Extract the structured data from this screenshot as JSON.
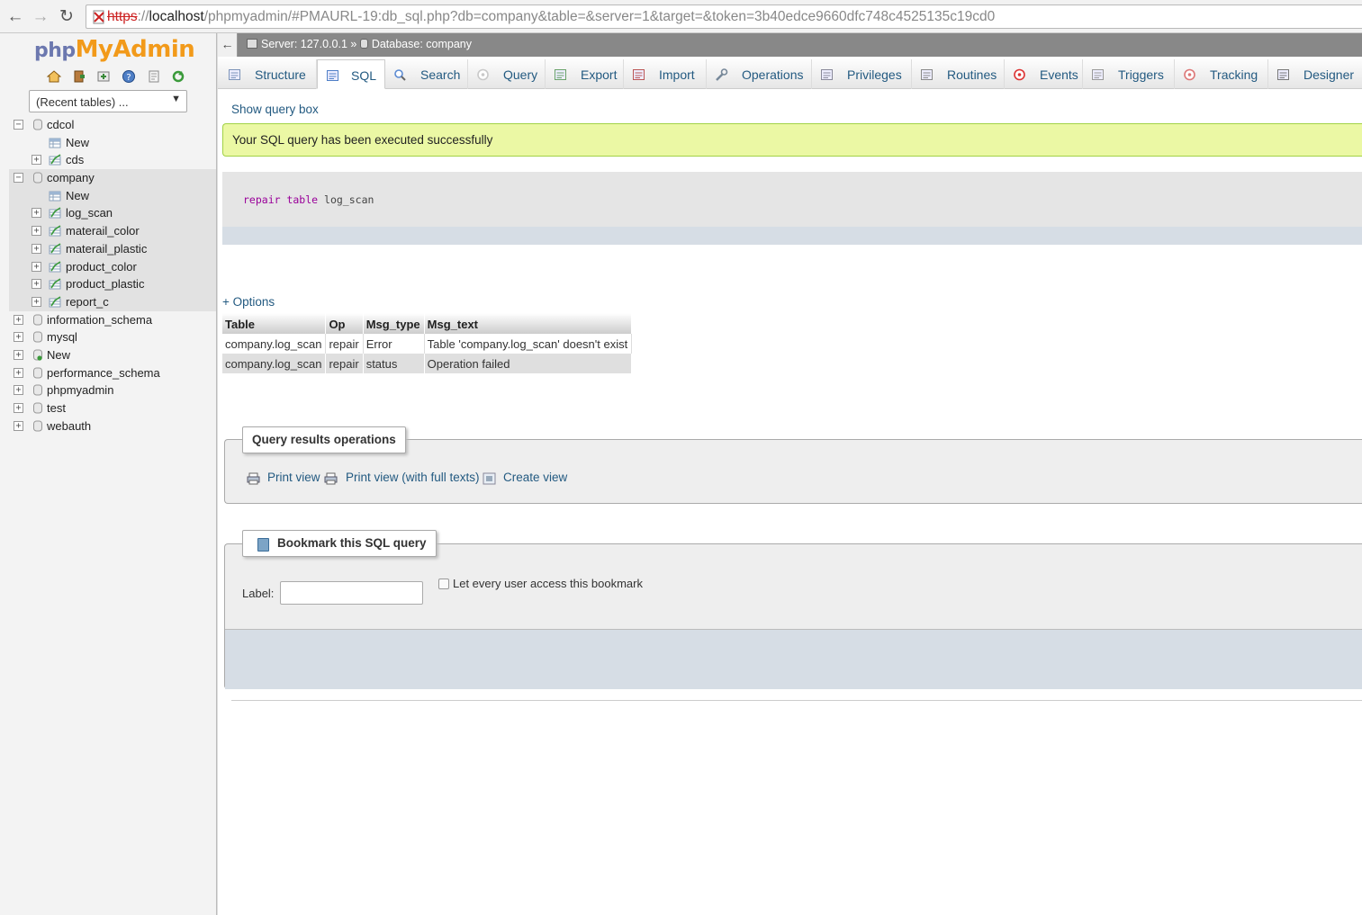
{
  "browser": {
    "url_scheme": "https",
    "url_host": "localhost",
    "url_rest": "/phpmyadmin/#PMAURL-19:db_sql.php?db=company&table=&server=1&target=&token=3b40edce9660dfc748c4525135c19cd0",
    "back_icon": "back-arrow-icon",
    "forward_icon": "forward-arrow-icon",
    "reload_icon": "reload-icon"
  },
  "sidebar": {
    "logo_php": "php",
    "logo_myadmin": "MyAdmin",
    "recent_tables": "(Recent tables) ...",
    "tree": [
      {
        "label": "cdcol",
        "type": "db",
        "expanded": true
      },
      {
        "label": "New",
        "type": "new",
        "level": 1
      },
      {
        "label": "cds",
        "type": "table",
        "level": 1
      },
      {
        "label": "company",
        "type": "db",
        "expanded": true
      },
      {
        "label": "New",
        "type": "new",
        "level": 1
      },
      {
        "label": "log_scan",
        "type": "table",
        "level": 1
      },
      {
        "label": "materail_color",
        "type": "table",
        "level": 1
      },
      {
        "label": "materail_plastic",
        "type": "table",
        "level": 1
      },
      {
        "label": "product_color",
        "type": "table",
        "level": 1
      },
      {
        "label": "product_plastic",
        "type": "table",
        "level": 1
      },
      {
        "label": "report_c",
        "type": "table",
        "level": 1
      },
      {
        "label": "information_schema",
        "type": "db"
      },
      {
        "label": "mysql",
        "type": "db"
      },
      {
        "label": "New",
        "type": "newdb"
      },
      {
        "label": "performance_schema",
        "type": "db"
      },
      {
        "label": "phpmyadmin",
        "type": "db"
      },
      {
        "label": "test",
        "type": "db"
      },
      {
        "label": "webauth",
        "type": "db"
      }
    ]
  },
  "topbar": {
    "collapse": "←",
    "server": "Server: 127.0.0.1",
    "separator": "»",
    "database": "Database: company"
  },
  "tabs": [
    {
      "label": "Structure",
      "icon": "structure-icon"
    },
    {
      "label": "SQL",
      "icon": "sql-icon",
      "active": true
    },
    {
      "label": "Search",
      "icon": "search-icon"
    },
    {
      "label": "Query",
      "icon": "query-icon"
    },
    {
      "label": "Export",
      "icon": "export-icon"
    },
    {
      "label": "Import",
      "icon": "import-icon"
    },
    {
      "label": "Operations",
      "icon": "wrench-icon"
    },
    {
      "label": "Privileges",
      "icon": "privileges-icon"
    },
    {
      "label": "Routines",
      "icon": "routines-icon"
    },
    {
      "label": "Events",
      "icon": "clock-icon"
    },
    {
      "label": "Triggers",
      "icon": "triggers-icon"
    },
    {
      "label": "Tracking",
      "icon": "eye-icon"
    },
    {
      "label": "Designer",
      "icon": "designer-icon"
    }
  ],
  "main": {
    "show_query_box": "Show query box",
    "success_message": "Your SQL query has been executed successfully",
    "sql_keyword": "repair table",
    "sql_identifier": "log_scan",
    "options": "+ Options",
    "results": {
      "headers": [
        "Table",
        "Op",
        "Msg_type",
        "Msg_text"
      ],
      "rows": [
        [
          "company.log_scan",
          "repair",
          "Error",
          "Table 'company.log_scan' doesn't exist"
        ],
        [
          "company.log_scan",
          "repair",
          "status",
          "Operation failed"
        ]
      ]
    },
    "query_results_operations": {
      "legend": "Query results operations",
      "print_view": "Print view",
      "print_view_full": "Print view (with full texts)",
      "create_view": "Create view"
    },
    "bookmark": {
      "legend": "Bookmark this SQL query",
      "label": "Label:",
      "label_value": "",
      "share_label": "Let every user access this bookmark"
    }
  },
  "colors": {
    "link": "#235a81",
    "success_bg": "#ebf8a4",
    "logo_orange": "#f29a1a",
    "logo_blue": "#6c78af"
  }
}
